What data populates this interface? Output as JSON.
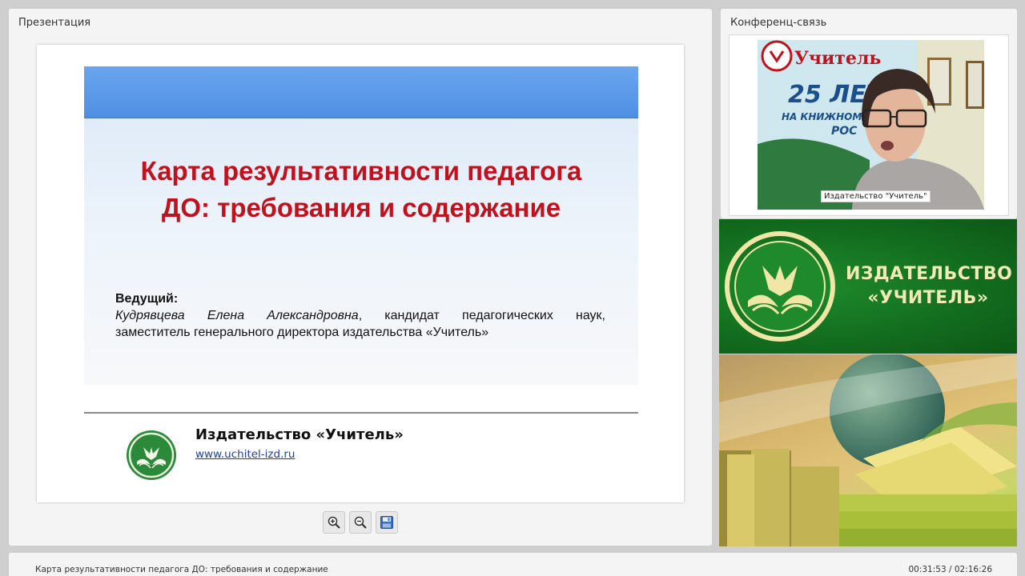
{
  "presentation": {
    "panel_title": "Презентация",
    "slide": {
      "title_line1": "Карта результативности педагога",
      "title_line2": "ДО: требования и содержание",
      "presenter_label": "Ведущий:",
      "presenter_name": "Кудрявцева Елена Александровна",
      "presenter_role_part1": ", кандидат педагогических наук,",
      "presenter_role_part2": "заместитель генерального директора издательства «Учитель»",
      "publisher_name": "Издательство «Учитель»",
      "publisher_url": "www.uchitel-izd.ru"
    },
    "toolbar": {
      "zoom_in_icon": "zoom-in-icon",
      "zoom_out_icon": "zoom-out-icon",
      "save_icon": "save-icon"
    }
  },
  "conference": {
    "panel_title": "Конференц-связь",
    "video_caption": "Издательство \"Учитель\"",
    "backdrop_text_top": "Учитель",
    "backdrop_text_mid": "25 ЛЕТ",
    "backdrop_text_sub": "НА КНИЖНОМ",
    "backdrop_text_sub2": "РОС"
  },
  "banner": {
    "line1": "ИЗДАТЕЛЬСТВО",
    "line2": "«УЧИТЕЛЬ»"
  },
  "status": {
    "title": "Карта результативности педагога ДО: требования и содержание",
    "time": "00:31:53 / 02:16:26"
  },
  "colors": {
    "slide_title": "#c0111c",
    "slide_bar": "#4f8fe3",
    "banner_green": "#136e1f",
    "banner_text": "#f2e9b4"
  }
}
